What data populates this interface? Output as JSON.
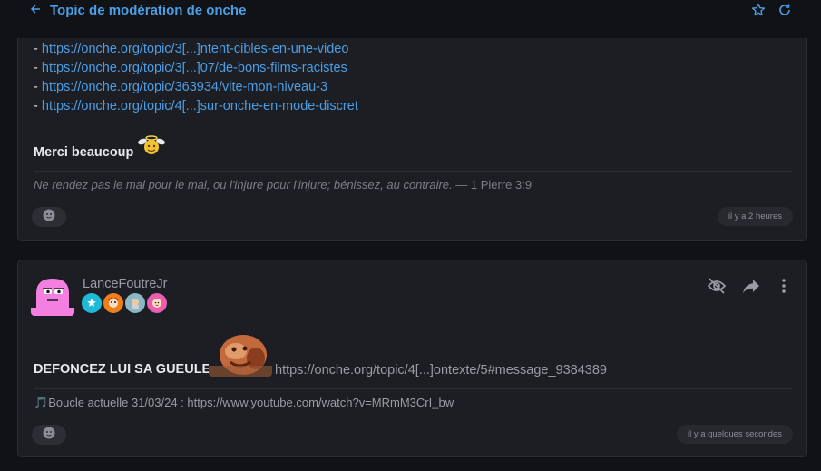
{
  "header": {
    "title": "Topic de modération de onche",
    "back_icon": "arrow-left-icon",
    "star_icon": "star-icon",
    "refresh_icon": "refresh-icon"
  },
  "post1": {
    "links": [
      "https://onche.org/topic/3[...]ntent-cibles-en-une-video",
      "https://onche.org/topic/3[...]07/de-bons-films-racistes",
      "https://onche.org/topic/363934/vite-mon-niveau-3",
      "https://onche.org/topic/4[...]sur-onche-en-mode-discret"
    ],
    "dash": "-",
    "thanks": "Merci beaucoup",
    "signature_quote": "Ne rendez pas le mal pour le mal, ou l'injure pour l'injure; bénissez, au contraire.",
    "signature_ref": " — 1 Pierre 3:9",
    "timestamp": "il y a 2 heures"
  },
  "post2": {
    "username": "LanceFoutreJr",
    "message": "DEFONCEZ LUI SA GUEULE",
    "link": "https://onche.org/topic/4[...]ontexte/5#message_9384389",
    "music_note": "🎵",
    "signature": "Boucle actuelle 31/03/24 : https://www.youtube.com/watch?v=MRmM3CrI_bw",
    "timestamp": "il y a quelques secondes"
  },
  "colors": {
    "accent": "#4b9ee6",
    "card_bg": "#1d1e23",
    "page_bg": "#111215"
  }
}
